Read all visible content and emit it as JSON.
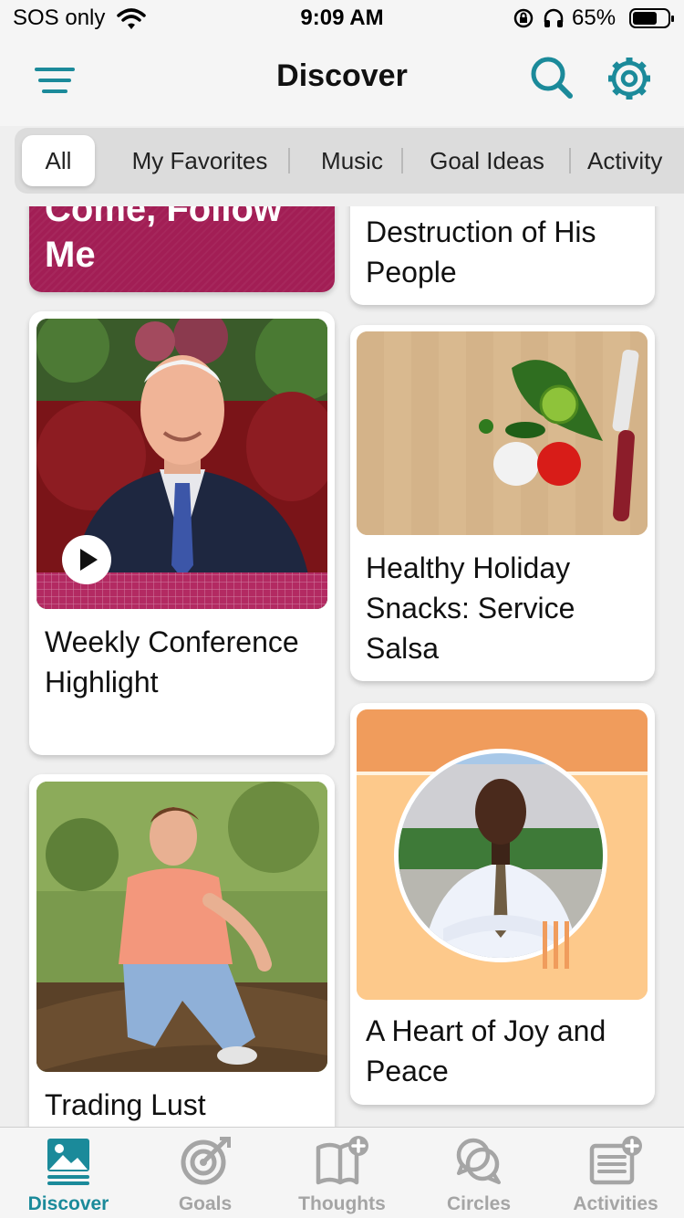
{
  "status_bar": {
    "carrier": "SOS only",
    "time": "9:09 AM",
    "battery": "65%"
  },
  "header": {
    "title": "Discover"
  },
  "tabs": [
    {
      "label": "All",
      "active": true
    },
    {
      "label": "My Favorites"
    },
    {
      "label": "Music"
    },
    {
      "label": "Goal Ideas"
    },
    {
      "label": "Activity"
    }
  ],
  "cards": {
    "follow_me": {
      "label": "Come, Follow Me"
    },
    "destruction": {
      "title": "Destruction of His People"
    },
    "weekly": {
      "title": "Weekly Conference Highlight"
    },
    "salsa": {
      "title": "Healthy Holiday Snacks: Service Salsa"
    },
    "joy": {
      "title": "A Heart of Joy and Peace"
    },
    "trading": {
      "title": "Trading Lust"
    }
  },
  "tabbar": [
    {
      "label": "Discover",
      "icon": "image-icon",
      "active": true
    },
    {
      "label": "Goals",
      "icon": "target-icon"
    },
    {
      "label": "Thoughts",
      "icon": "book-plus-icon"
    },
    {
      "label": "Circles",
      "icon": "chat-circles-icon"
    },
    {
      "label": "Activities",
      "icon": "list-plus-icon"
    }
  ],
  "colors": {
    "accent": "#1b8a9a",
    "follow_me_bg": "#a21e55",
    "joy_bg": "#fdc98b",
    "joy_top": "#f09c5c"
  }
}
